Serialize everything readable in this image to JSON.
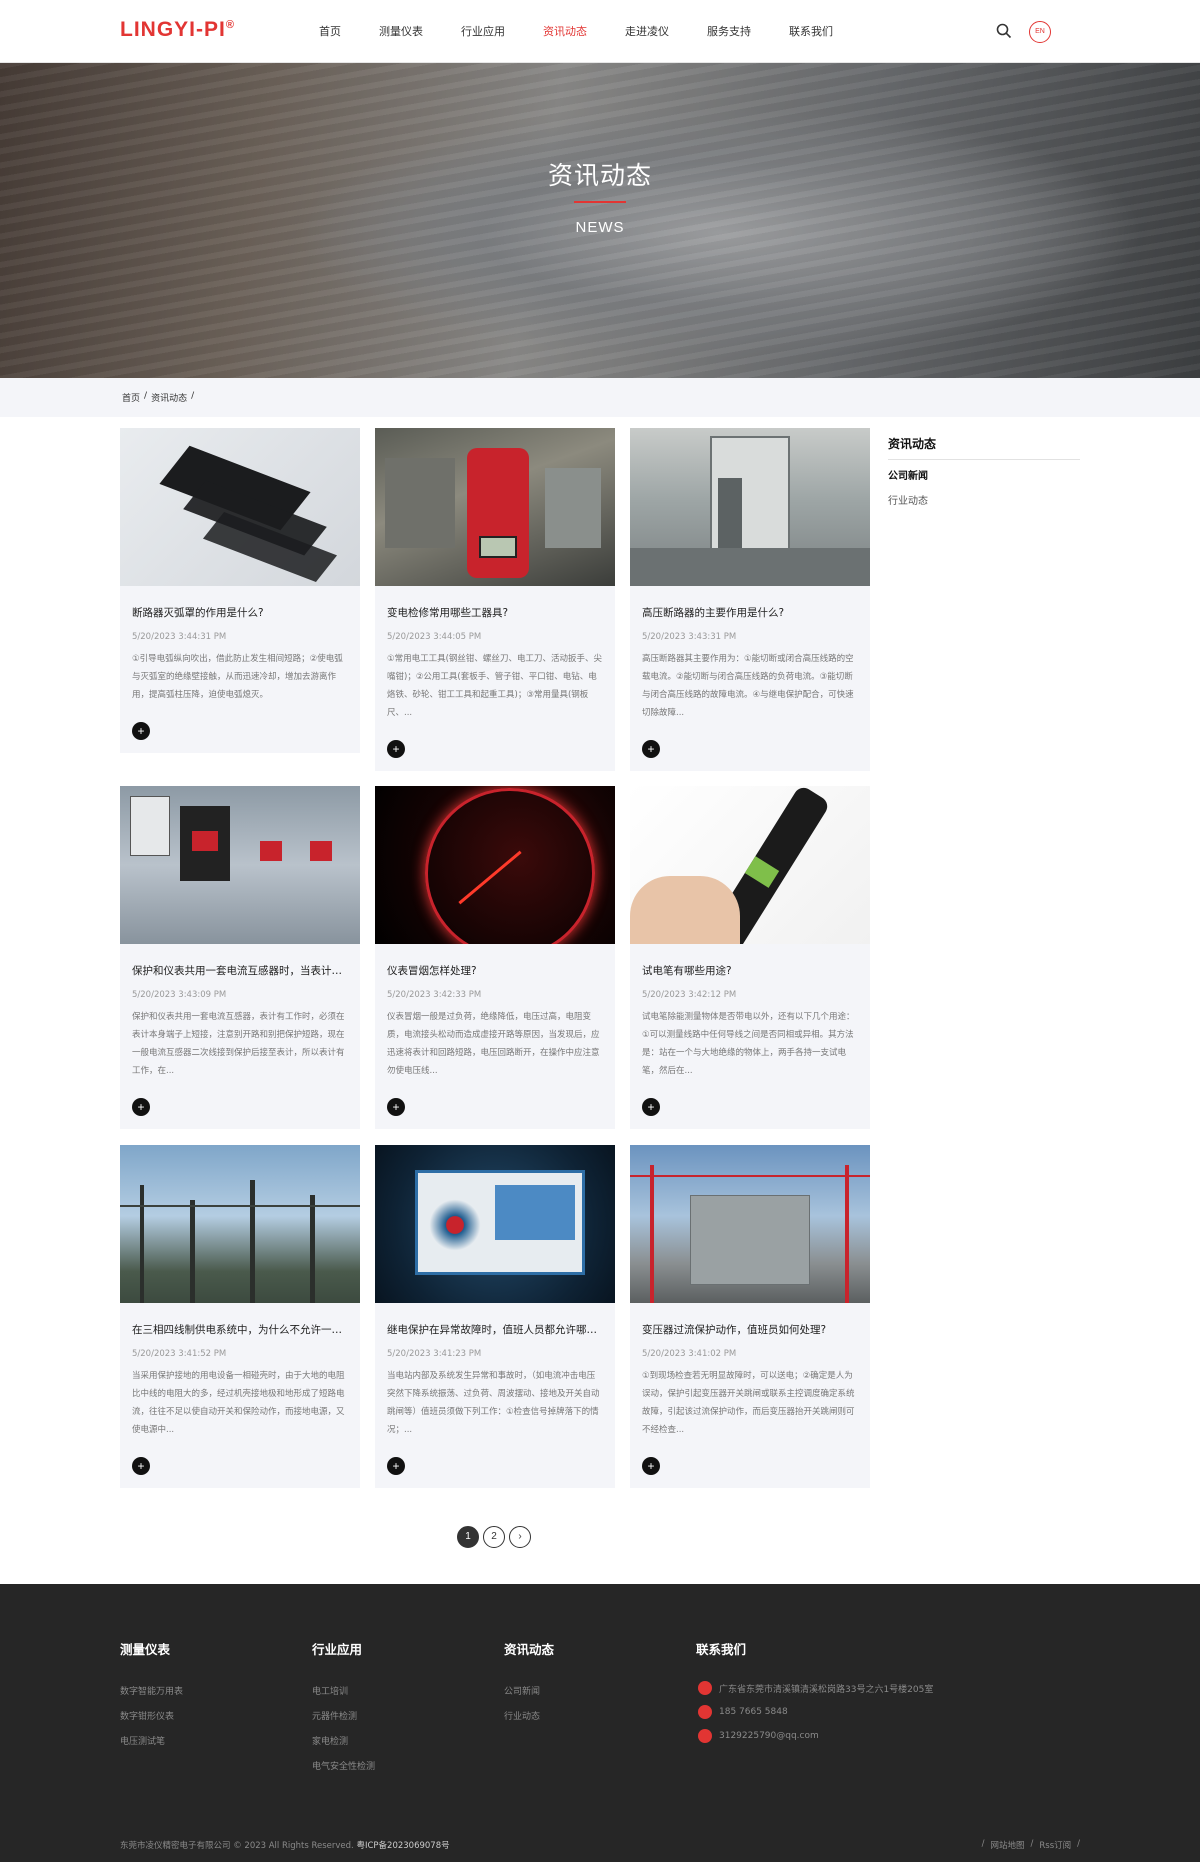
{
  "header": {
    "logo": "LINGYI-PI",
    "logo_mark": "®",
    "nav": [
      "首页",
      "测量仪表",
      "行业应用",
      "资讯动态",
      "走进凌仪",
      "服务支持",
      "联系我们"
    ],
    "active_nav": "资讯动态",
    "lang": "EN",
    "icons": [
      "search-icon"
    ]
  },
  "banner": {
    "title": "资讯动态",
    "subtitle": "NEWS"
  },
  "breadcrumb": [
    "首页",
    "/",
    "资讯动态",
    "/"
  ],
  "cards": [
    {
      "title": "断路器灭弧罩的作用是什么?",
      "date": "5/20/2023 3:44:31 PM",
      "desc": "①引导电弧纵向吹出，借此防止发生相间短路；②使电弧与灭弧室的绝缘壁接触，从而迅速冷却，增加去游离作用，提高弧柱压降，迫使电弧熄灭。"
    },
    {
      "title": "变电检修常用哪些工器具?",
      "date": "5/20/2023 3:44:05 PM",
      "desc": "①常用电工工具(钢丝钳、螺丝刀、电工刀、活动扳手、尖嘴钳)；②公用工具(套板手、管子钳、平口钳、电钻、电烙铁、砂轮、钳工工具和起重工具)；③常用量具(钢板尺、..."
    },
    {
      "title": "高压断路器的主要作用是什么?",
      "date": "5/20/2023 3:43:31 PM",
      "desc": "高压断路器其主要作用为：①能切断或闭合高压线路的空载电流。②能切断与闭合高压线路的负荷电流。③能切断与闭合高压线路的故障电流。④与继电保护配合，可快速切除故障..."
    },
    {
      "title": "保护和仪表共用一套电流互感器时，当表计回路有工作时，如何短接？",
      "date": "5/20/2023 3:43:09 PM",
      "desc": "保护和仪表共用一套电流互感器，表计有工作时，必须在表计本身端子上短接，注意别开路和别把保护短路，现在一般电流互感器二次线接到保护后接至表计，所以表计有工作，在..."
    },
    {
      "title": "仪表冒烟怎样处理?",
      "date": "5/20/2023 3:42:33 PM",
      "desc": "仪表冒烟一般是过负荷，绝缘降低，电压过高，电阻变质，电流接头松动而造成虚接开路等原因，当发现后，应迅速将表计和回路短路，电压回路断开，在操作中应注意勿使电压线..."
    },
    {
      "title": "试电笔有哪些用途?",
      "date": "5/20/2023 3:42:12 PM",
      "desc": "试电笔除能测量物体是否带电以外，还有以下几个用途：①可以测量线路中任何导线之间是否同相或异相。其方法是：站在一个与大地绝缘的物体上，两手各持一支试电笔，然后在..."
    },
    {
      "title": "在三相四线制供电系统中，为什么不允许一部分设备接零，而另一部分设备接地？",
      "date": "5/20/2023 3:41:52 PM",
      "desc": "当采用保护接地的用电设备一相碰壳时，由于大地的电阻比中线的电阻大的多，经过机壳接地极和地形成了短路电流，往往不足以使自动开关和保险动作，而接地电源，又使电源中..."
    },
    {
      "title": "继电保护在异常故障时，值班人员都允许哪些工作？",
      "date": "5/20/2023 3:41:23 PM",
      "desc": "当电站内部及系统发生异常和事故时，（如电流冲击电压突然下降系统振荡、过负荷、周波摆动、接地及开关自动跳闸等）值班员须做下列工作：①检查信号掉牌落下的情况；..."
    },
    {
      "title": "变压器过流保护动作，值班员如何处理?",
      "date": "5/20/2023 3:41:02 PM",
      "desc": "①到现场检查若无明显故障时，可以送电；②确定是人为误动，保护引起变压器开关跳闸或联系主控调度确定系统故障，引起该过流保护动作，而后变压器抬开关跳闸则可不经检查..."
    }
  ],
  "sidebar": {
    "title": "资讯动态",
    "items": [
      "公司新闻",
      "行业动态"
    ],
    "active": "公司新闻"
  },
  "pagination": {
    "pages": [
      "1",
      "2"
    ],
    "current": "1",
    "next": "›"
  },
  "footer": {
    "columns": [
      {
        "title": "测量仪表",
        "links": [
          "数字智能万用表",
          "数字钳形仪表",
          "电压测试笔"
        ]
      },
      {
        "title": "行业应用",
        "links": [
          "电工培训",
          "元器件检测",
          "家电检测",
          "电气安全性检测"
        ]
      },
      {
        "title": "资讯动态",
        "links": [
          "公司新闻",
          "行业动态"
        ]
      }
    ],
    "contact_title": "联系我们",
    "contacts": [
      {
        "icon": "location-icon",
        "text": "广东省东莞市清溪镇清溪松岗路33号之六1号楼205室"
      },
      {
        "icon": "phone-icon",
        "text": "185 7665 5848"
      },
      {
        "icon": "mail-icon",
        "text": "3129225790@qq.com"
      }
    ],
    "copyright": "东莞市凌仪精密电子有限公司 © 2023 All Rights Reserved.",
    "icp": "粤ICP备2023069078号",
    "bottom_links": [
      "/",
      "网站地图",
      "/",
      "Rss订阅",
      "/"
    ]
  },
  "colors": {
    "accent": "#e23533",
    "footer_bg": "#262626",
    "card_bg": "#f4f5f9"
  }
}
